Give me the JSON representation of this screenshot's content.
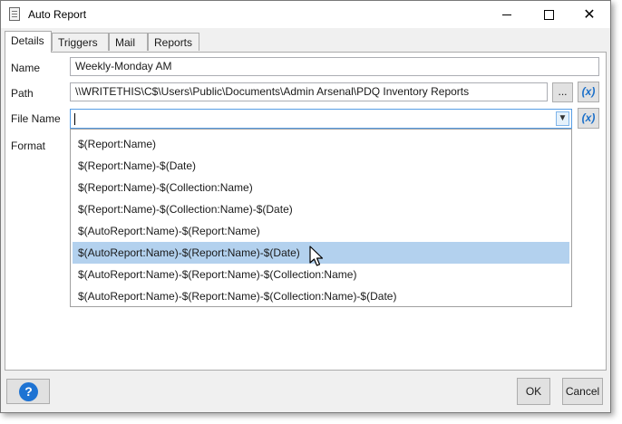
{
  "window": {
    "title": "Auto Report",
    "controls": {
      "minimize": "minimize",
      "maximize": "maximize",
      "close": "✕"
    }
  },
  "tabs": [
    {
      "label": "Details",
      "active": true
    },
    {
      "label": "Triggers",
      "active": false
    },
    {
      "label": "Mail",
      "active": false
    },
    {
      "label": "Reports",
      "active": false
    }
  ],
  "form": {
    "name_label": "Name",
    "name_value": "Weekly-Monday AM",
    "path_label": "Path",
    "path_value": "\\\\WRITETHIS\\C$\\Users\\Public\\Documents\\Admin Arsenal\\PDQ Inventory Reports",
    "browse_label": "...",
    "variable_button_label": "(x)",
    "file_name_label": "File Name",
    "file_name_value": "",
    "format_label": "Format"
  },
  "dropdown": {
    "options": [
      "$(Report:Name)",
      "$(Report:Name)-$(Date)",
      "$(Report:Name)-$(Collection:Name)",
      "$(Report:Name)-$(Collection:Name)-$(Date)",
      "$(AutoReport:Name)-$(Report:Name)",
      "$(AutoReport:Name)-$(Report:Name)-$(Date)",
      "$(AutoReport:Name)-$(Report:Name)-$(Collection:Name)",
      "$(AutoReport:Name)-$(Report:Name)-$(Collection:Name)-$(Date)"
    ],
    "highlighted_index": 5
  },
  "footer": {
    "help_label": "?",
    "ok_label": "OK",
    "cancel_label": "Cancel"
  },
  "colors": {
    "accent": "#1e73d3",
    "selection": "#b3d1ee",
    "focus_border": "#569de5"
  }
}
